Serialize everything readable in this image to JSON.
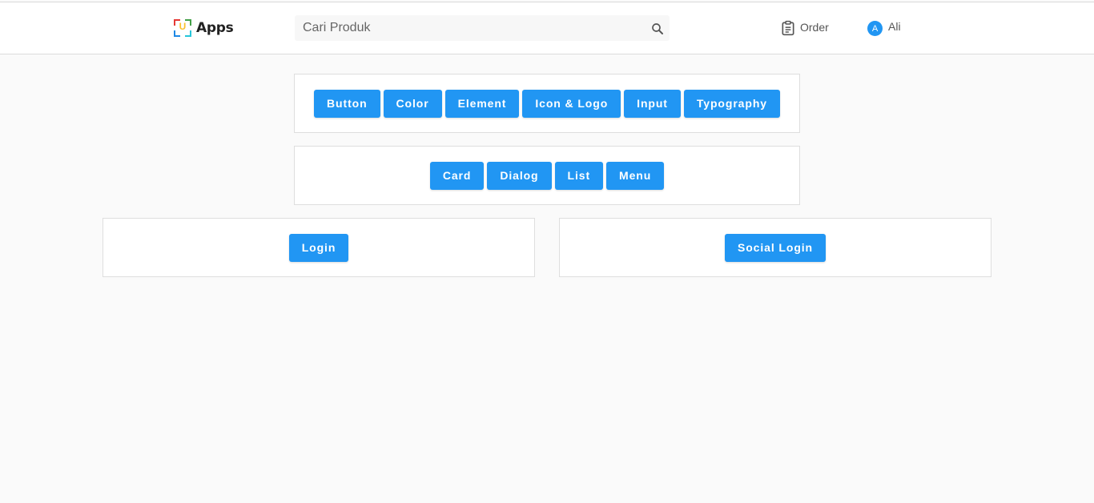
{
  "header": {
    "logo_text": "Apps",
    "logo_mark_letter": "U",
    "search": {
      "placeholder": "Cari Produk",
      "value": ""
    },
    "order_label": "Order",
    "user": {
      "avatar_initial": "A",
      "name": "Ali"
    }
  },
  "groups": {
    "general": [
      "Button",
      "Color",
      "Element",
      "Icon & Logo",
      "Input",
      "Typography"
    ],
    "components": [
      "Card",
      "Dialog",
      "List",
      "Menu"
    ],
    "login": "Login",
    "social_login": "Social Login"
  },
  "colors": {
    "accent": "#2196f3",
    "background": "#fafafa",
    "surface": "#ffffff"
  },
  "icons": {
    "search": "search-icon",
    "order": "clipboard-icon"
  }
}
